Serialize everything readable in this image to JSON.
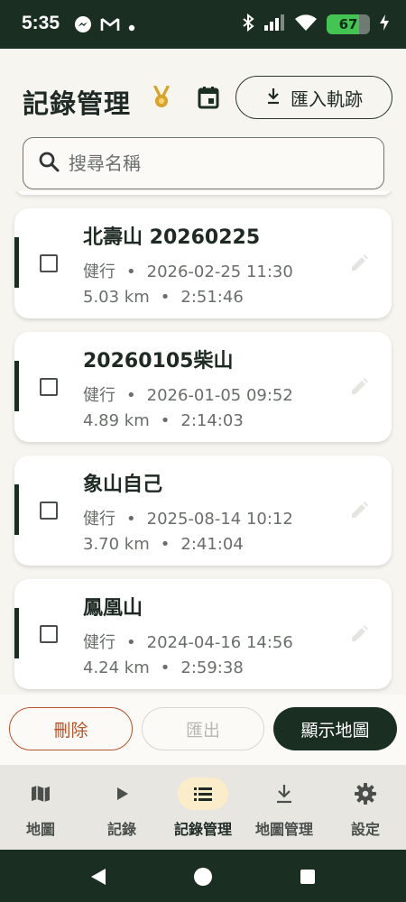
{
  "status_bar": {
    "time": "5:35",
    "battery": "67",
    "icons": [
      "messenger-icon",
      "gmail-icon",
      "dot-icon",
      "bluetooth-icon",
      "signal-icon",
      "wifi-icon",
      "battery-icon",
      "charging-icon"
    ]
  },
  "header": {
    "title": "記錄管理",
    "medal_icon": "medal-icon",
    "calendar_icon": "calendar-icon",
    "import_label": "匯入軌跡",
    "import_icon": "download-icon"
  },
  "search": {
    "placeholder": "搜尋名稱",
    "value": ""
  },
  "records": [
    {
      "name": "北壽山 20260225",
      "activity": "健行",
      "datetime": "2026-02-25 11:30",
      "distance": "5.03 km",
      "duration": "2:51:46"
    },
    {
      "name": "20260105柴山",
      "activity": "健行",
      "datetime": "2026-01-05 09:52",
      "distance": "4.89 km",
      "duration": "2:14:03"
    },
    {
      "name": "象山自己",
      "activity": "健行",
      "datetime": "2025-08-14 10:12",
      "distance": "3.70 km",
      "duration": "2:41:04"
    },
    {
      "name": "鳳凰山",
      "activity": "健行",
      "datetime": "2024-04-16 14:56",
      "distance": "4.24 km",
      "duration": "2:59:38"
    }
  ],
  "separator": "•",
  "actions": {
    "delete": "刪除",
    "export": "匯出",
    "show_map": "顯示地圖"
  },
  "bottom_nav": [
    {
      "label": "地圖",
      "icon": "map-icon",
      "active": false
    },
    {
      "label": "記錄",
      "icon": "play-icon",
      "active": false
    },
    {
      "label": "記錄管理",
      "icon": "list-icon",
      "active": true
    },
    {
      "label": "地圖管理",
      "icon": "download-icon",
      "active": false
    },
    {
      "label": "設定",
      "icon": "gear-icon",
      "active": false
    }
  ],
  "colors": {
    "primary": "#1b2e22",
    "accent_yellow": "#fbedc9",
    "delete": "#b4542b",
    "medal": "#d9a22a",
    "battery": "#44c553"
  }
}
